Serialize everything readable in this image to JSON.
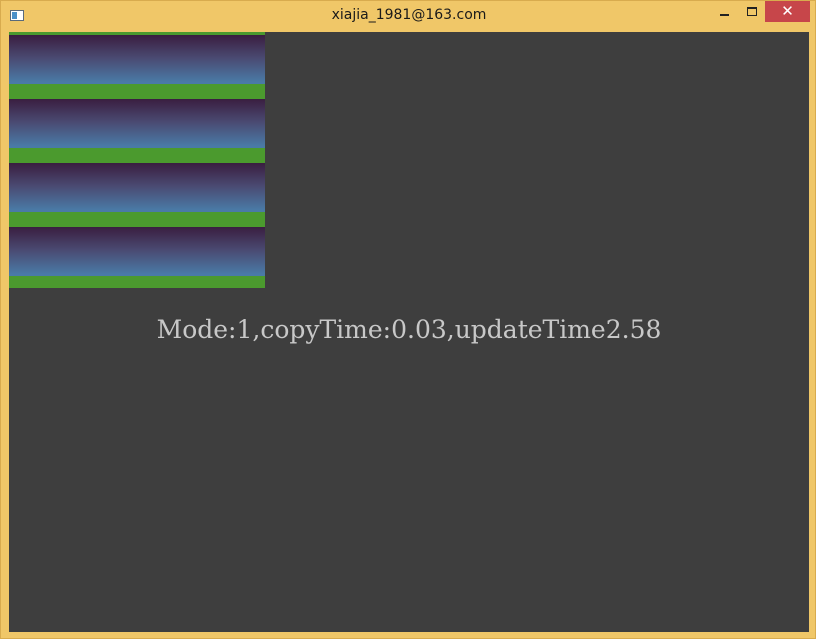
{
  "window": {
    "title": "xiajia_1981@163.com",
    "icons": {
      "app": "app-window-icon",
      "minimize": "minimize-icon",
      "maximize": "maximize-icon",
      "close": "close-icon"
    },
    "close_glyph": "✕",
    "colors": {
      "frame": "#f0c768",
      "client_bg": "#3e3e3e",
      "close_button": "#c7464a",
      "status_text": "#c8c8c8"
    }
  },
  "canvas": {
    "tile_count": 4,
    "tile_gradient_colors": [
      "#4b9a2e",
      "#3a1e40",
      "#4a4a72",
      "#4a7aa6",
      "#4b9a2e"
    ],
    "status_text": "Mode:1,copyTime:0.03,updateTime2.58"
  }
}
